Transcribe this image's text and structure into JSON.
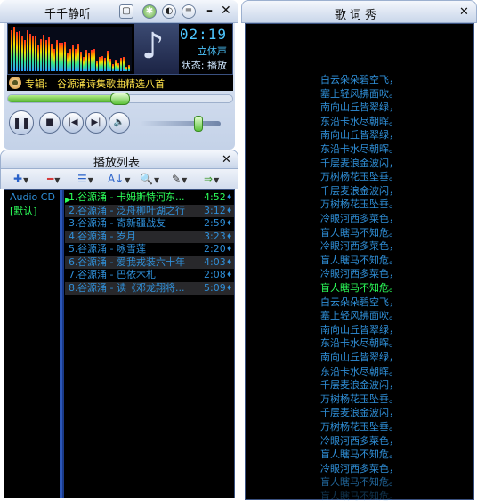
{
  "colors": {
    "lyric_normal": "#2f8fd8",
    "lyric_current": "#2cff5a",
    "playlist_text": "#2f8fd8",
    "current_track": "#2cff5a",
    "time_display": "#4ec7ff"
  },
  "player": {
    "title": "千千静听",
    "buttons": {
      "app_menu_icon": "window-icon",
      "eq_icon": "equalizer-icon",
      "visual_icon": "visualizer-icon",
      "list_icon": "list-icon",
      "minimize": "–",
      "close": "✕"
    },
    "time": "02:19",
    "stereo": "立体声",
    "status_label": "状态:",
    "status_value": "播放",
    "album_label": "专辑:",
    "album": "谷源涌诗集歌曲精选八首",
    "seek_progress": 0.5,
    "volume_level": 0.72,
    "controls": {
      "pause": "❚❚",
      "stop": "■",
      "prev": "|◀",
      "next": "▶|",
      "volume_icon": "🔈"
    }
  },
  "playlist": {
    "title": "播放列表",
    "close": "✕",
    "toolbar": {
      "add": "✚",
      "remove": "━",
      "list": "☰",
      "sort": "A↓",
      "search": "🔍",
      "edit": "✎",
      "mode": "⇒"
    },
    "categories": [
      "Audio CD",
      "[默认]"
    ],
    "tracks": [
      {
        "num": "1.",
        "title": "谷源涌 - 卡姆斯特河东...",
        "duration": "4:52"
      },
      {
        "num": "2.",
        "title": "谷源涌 - 泛舟柳叶湖之行",
        "duration": "3:12"
      },
      {
        "num": "3.",
        "title": "谷源涌 - 寄新疆战友",
        "duration": "2:59"
      },
      {
        "num": "4.",
        "title": "谷源涌 - 岁月",
        "duration": "3:23"
      },
      {
        "num": "5.",
        "title": "谷源涌 - 咏雪莲",
        "duration": "2:20"
      },
      {
        "num": "6.",
        "title": "谷源涌 - 爱我戎装六十年",
        "duration": "4:03"
      },
      {
        "num": "7.",
        "title": "谷源涌 - 巴依木札",
        "duration": "2:08"
      },
      {
        "num": "8.",
        "title": "谷源涌 - 读《邓龙翔将...",
        "duration": "5:09"
      }
    ],
    "current_index": 0
  },
  "lyrics": {
    "title": "歌词秀",
    "close": "✕",
    "current_index": 15,
    "lines": [
      "白云朵朵碧空飞，",
      "塞上轻风拂面吹。",
      "南向山丘皆翠绿，",
      "东沿卡水尽朝晖。",
      "南向山丘皆翠绿，",
      "东沿卡水尽朝晖。",
      "千层麦浪金波闪，",
      "万树杨花玉坠垂。",
      "千层麦浪金波闪，",
      "万树杨花玉坠垂。",
      "冷眼河西多菜色，",
      "盲人瞎马不知危。",
      "冷眼河西多菜色，",
      "盲人瞎马不知危。",
      "冷眼河西多菜色，",
      "盲人瞎马不知危。",
      "白云朵朵碧空飞，",
      "塞上轻风拂面吹。",
      "南向山丘皆翠绿，",
      "东沿卡水尽朝晖。",
      "南向山丘皆翠绿，",
      "东沿卡水尽朝晖。",
      "千层麦浪金波闪，",
      "万树杨花玉坠垂。",
      "千层麦浪金波闪，",
      "万树杨花玉坠垂。",
      "冷眼河西多菜色，",
      "盲人瞎马不知危。",
      "冷眼河西多菜色，",
      "盲人瞎马不知危。",
      "盲人瞎马不知危。"
    ]
  }
}
